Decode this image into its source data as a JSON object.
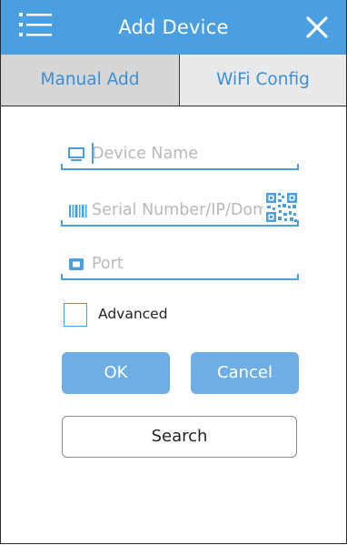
{
  "header": {
    "title": "Add Device",
    "menu_icon": "menu-list-icon",
    "close_icon": "close-icon",
    "accent_color": "#4a9fe0"
  },
  "tabs": [
    {
      "label": "Manual Add",
      "active": true
    },
    {
      "label": "WiFi Config",
      "active": false
    }
  ],
  "form": {
    "device_name": {
      "placeholder": "Device Name",
      "value": "",
      "icon": "monitor-icon"
    },
    "serial": {
      "placeholder": "Serial Number/IP/Domain",
      "value": "",
      "icon": "barcode-icon",
      "scan_icon": "qr-code-icon"
    },
    "port": {
      "placeholder": "Port",
      "value": "",
      "icon": "port-icon"
    },
    "advanced": {
      "label": "Advanced",
      "checked": false
    }
  },
  "buttons": {
    "ok": "OK",
    "cancel": "Cancel",
    "search": "Search"
  }
}
